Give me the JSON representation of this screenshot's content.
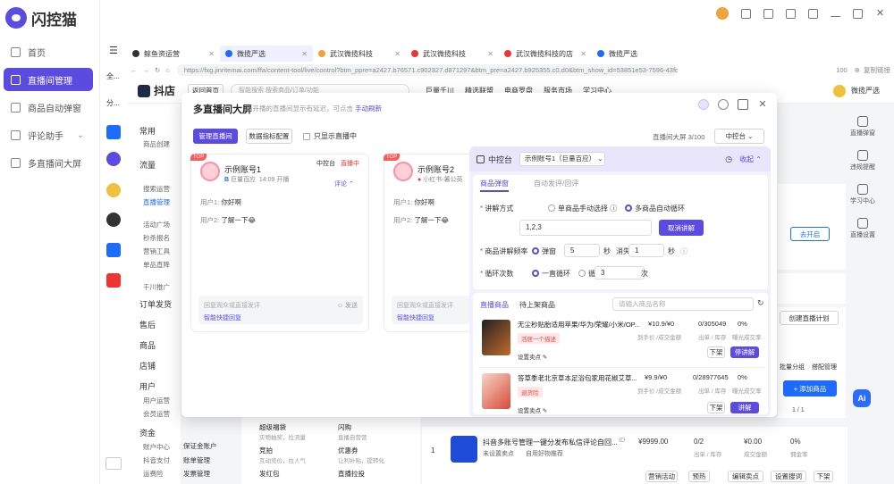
{
  "brand": {
    "name": "闪控猫"
  },
  "left_nav": [
    {
      "label": "首页",
      "active": false
    },
    {
      "label": "直播间管理",
      "active": true
    },
    {
      "label": "商品自动弹窗",
      "active": false
    },
    {
      "label": "评论助手",
      "active": false,
      "has_chevron": true
    },
    {
      "label": "多直播间大屏",
      "active": false
    }
  ],
  "browser_tabs": [
    {
      "label": "鲸鱼资运营",
      "color": "#333333",
      "active": false
    },
    {
      "label": "微揽严选",
      "color": "#1e6bff",
      "active": true
    },
    {
      "label": "武汉微揽科技",
      "color": "#f0a33c",
      "active": false
    },
    {
      "label": "武汉微揽科技",
      "color": "#e33",
      "active": false
    },
    {
      "label": "武汉微揽科技的店",
      "color": "#e33",
      "active": false
    },
    {
      "label": "微揽严选",
      "color": "#1e6bff",
      "active": false
    }
  ],
  "rail_labels": [
    "全...",
    "分..."
  ],
  "address": {
    "url": "https://fxg.jinritemai.com/ffa/content-tool/live/control?btm_ppre=a2427.b76571.c902327.d871297&btm_pre=a2427.b925355.c0.d0&btm_show_id=53851e53-7596-43fd-8e30-be25d384900f",
    "zoom": "100",
    "copy_link": "复制链接"
  },
  "shop_header": {
    "logo": "抖店",
    "back": "返回首页",
    "search_placeholder": "智能搜索 搜索商品/订单/功能",
    "menu": [
      "巨量千川",
      "精选联盟",
      "电商罗盘",
      "服务市场",
      "学习中心"
    ],
    "shop_name": "微揽严选"
  },
  "shop_side": [
    {
      "group": "常用",
      "items": [
        "商品创建"
      ]
    },
    {
      "group": "流量",
      "items": [
        "搜索运营",
        "直播管理",
        "活动广场",
        "秒杀报名",
        "营销工具",
        "单品直降",
        "千川推广"
      ]
    },
    {
      "group": "订单发货",
      "items": []
    },
    {
      "group": "售后",
      "items": []
    },
    {
      "group": "商品",
      "items": []
    },
    {
      "group": "店铺",
      "items": []
    },
    {
      "group": "用户",
      "items": [
        "用户运营",
        "会员运营"
      ]
    },
    {
      "group": "资金",
      "items": [
        "账户中心",
        "抖音支付",
        "运费险"
      ]
    }
  ],
  "right_tools": [
    "直播弹窗",
    "违规提醒",
    "学习中心",
    "直播设置"
  ],
  "modal": {
    "title": "多直播间大屏",
    "desc": "新开播的直播间显示有延迟，可点击",
    "desc_link": "手动刷新",
    "btn_manage": "管理直播间",
    "btn_metrics": "数据指标配置",
    "only_live": "只显示直播中",
    "screen_label": "直播间大屏",
    "screen_count": "3/100",
    "control_label": "中控台"
  },
  "anchors": [
    {
      "name": "示例账号1",
      "platform": "巨量百应",
      "time": "14:09 开播",
      "status": "直播中",
      "control": "中控台",
      "comments_label": "评论",
      "chats": [
        {
          "user": "用户1:",
          "text": "你好啊"
        },
        {
          "user": "用户2:",
          "text": "了解一下😂"
        }
      ],
      "input_placeholder": "回复观众或直接发评",
      "send": "发送",
      "quick_reply": "智能快捷回复"
    },
    {
      "name": "示例账号2",
      "platform": "小红书-薯公英",
      "time": "",
      "status": "",
      "control": "",
      "comments_label": "",
      "chats": [
        {
          "user": "用户1:",
          "text": "你好啊"
        },
        {
          "user": "用户2:",
          "text": "了解一下😂"
        }
      ],
      "input_placeholder": "回复观众或直接发评",
      "send": "",
      "quick_reply": "智能快捷回复"
    }
  ],
  "control_panel": {
    "title": "中控台",
    "account": "示例账号1（巨量百应）",
    "collapse": "收起",
    "tabs": [
      "商品弹窗",
      "自动发评/回评"
    ],
    "explain_mode_label": "讲解方式",
    "mode_manual": "单商品手动选择",
    "mode_auto": "多商品自动循环",
    "product_ids": "1,2,3",
    "cancel_explain": "取消讲解",
    "freq_label": "商品讲解频率",
    "popup_label": "弹窗",
    "popup_value": "5",
    "sec": "秒",
    "vanish_label": "消失",
    "vanish_value": "1",
    "loop_label": "循环次数",
    "loop_forever": "一直循环",
    "loop_count": "循环",
    "loop_value": "3",
    "times": "次",
    "list_tabs": [
      "直播商品",
      "待上架商品"
    ],
    "search_placeholder": "请输入商品名称",
    "products": [
      {
        "title": "无尘秒贴胎适用苹果/华为/荣耀/小米/OP...",
        "tag": "活居一个描述",
        "price": "¥10.9/¥0",
        "price_sub": "到手价 /成交金额",
        "stock": "0/305049",
        "stock_sub": "出单 / 库存",
        "rate": "0%",
        "rate_sub": "曝光成交率",
        "set_point": "设置卖点",
        "btn1": "下架",
        "btn2": "停讲解"
      },
      {
        "title": "答草季老北京草本足浴包家用花椒艾草...",
        "tag": "退货险",
        "price": "¥9.9/¥0",
        "price_sub": "到手价 /成交金额",
        "stock": "0/28977645",
        "stock_sub": "出单 / 库存",
        "rate": "0%",
        "rate_sub": "曝光成交率",
        "set_point": "设置卖点",
        "btn1": "下架",
        "btn2": "讲解"
      }
    ]
  },
  "background": {
    "go_live": "去开启",
    "create_plan": "创建直播计划",
    "add_product": "+ 添加商品",
    "batch": "批量分组",
    "pin": "搭配管理",
    "pager": "1 / 1",
    "tools": [
      {
        "title": "超级福袋",
        "desc": "实物抽奖，拉流量"
      },
      {
        "title": "闪购",
        "desc": "直播自营营"
      },
      {
        "title": "竞拍",
        "desc": "互动竞价，拉人气"
      },
      {
        "title": "优惠券",
        "desc": "让利补贴，提转化"
      },
      {
        "title": "发红包",
        "desc": "拉互动"
      },
      {
        "title": "直播拉投",
        "desc": ""
      }
    ],
    "side_more": [
      "保证金账户",
      "账单管理",
      "发票管理"
    ],
    "bottom_product": {
      "index": "1",
      "title": "抖音多账号管理一键分发布私信评论自回...",
      "id_label": "ID",
      "status": "未设置卖点",
      "auto": "自用好物推荐",
      "price": "¥9999.00",
      "stock": "0/2",
      "stock_sub": "出单 / 库存",
      "amount": "¥0.00",
      "amount_sub": "成交金额",
      "rate": "0%",
      "rate_sub": "佣金率",
      "actions": [
        "营销活动",
        "预热",
        "编辑卖点",
        "设置搜词",
        "下架"
      ]
    }
  }
}
